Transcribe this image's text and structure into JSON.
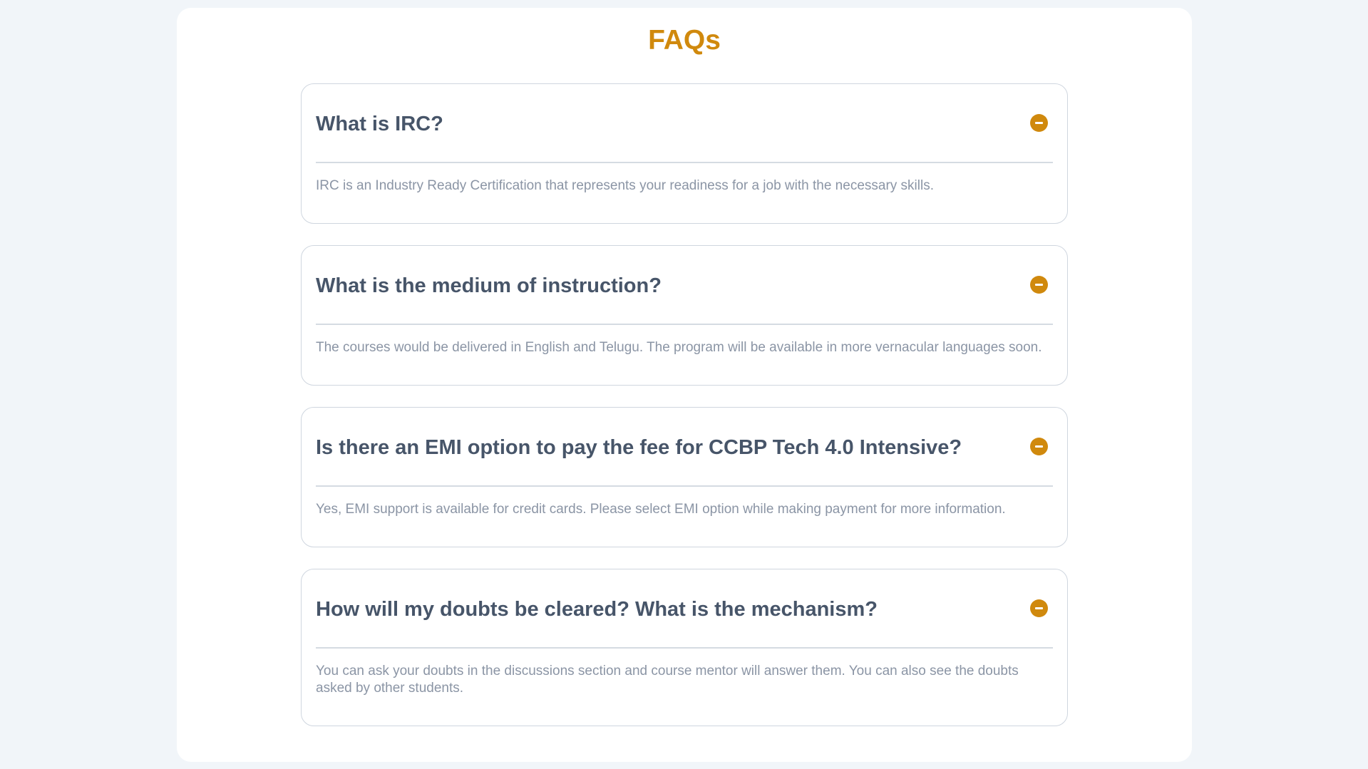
{
  "page": {
    "title": "FAQs"
  },
  "faqs": [
    {
      "question": "What is IRC?",
      "answer": "IRC is an Industry Ready Certification that represents your readiness for a job with the necessary skills.",
      "expanded": true
    },
    {
      "question": "What is the medium of instruction?",
      "answer": "The courses would be delivered in English and Telugu. The program will be available in more vernacular languages soon.",
      "expanded": true
    },
    {
      "question": "Is there an EMI option to pay the fee for CCBP Tech 4.0 Intensive?",
      "answer": "Yes, EMI support is available for credit cards. Please select EMI option while making payment for more information.",
      "expanded": true
    },
    {
      "question": "How will my doubts be cleared? What is the mechanism?",
      "answer": "You can ask your doubts in the discussions section and course mentor will answer them. You can also see the doubts asked by other students.",
      "expanded": true
    }
  ],
  "icons": {
    "toggle": "minus-circle-icon"
  },
  "colors": {
    "accent": "#d0890d",
    "question_text": "#475569",
    "answer_text": "#8b95a5",
    "page_background": "#f1f5f9",
    "card_background": "#ffffff"
  }
}
